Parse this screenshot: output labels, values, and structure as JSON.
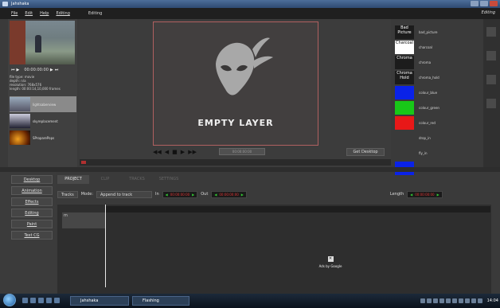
{
  "window": {
    "title": "Jahshaka",
    "mode_right": "Editing"
  },
  "menu": {
    "items": [
      "File",
      "Edit",
      "Help",
      "Editing"
    ],
    "mode_select": "Editing"
  },
  "preview": {
    "time": "00:00:00:00",
    "file_info": [
      "file type: movie",
      "depth: n/a",
      "resolution: 768x576",
      "length: 00:00:14,10,000 frames"
    ]
  },
  "clips": [
    {
      "label": "lightsaberview",
      "selected": true
    },
    {
      "label": "skyreplacement",
      "selected": false
    },
    {
      "label": "SProparePops",
      "selected": false
    }
  ],
  "viewport": {
    "empty_label": "EMPTY LAYER",
    "timecode": "00:00:00:00",
    "get_desktop_label": "Get Desktop"
  },
  "effects": [
    {
      "swatch_text": "Bad Picture",
      "swatch_color": "#1c1c1c",
      "swatch_text_color": "#ffffff",
      "name": "bad_picture"
    },
    {
      "swatch_text": "Charcoal",
      "swatch_color": "#ffffff",
      "swatch_text_color": "#000000",
      "name": "charcoal"
    },
    {
      "swatch_text": "Chroma",
      "swatch_color": "#1c1c1c",
      "swatch_text_color": "#ffffff",
      "name": "chroma"
    },
    {
      "swatch_text": "Chroma Hold",
      "swatch_color": "#1c1c1c",
      "swatch_text_color": "#ffffff",
      "name": "chroma_hold"
    },
    {
      "swatch_text": "",
      "swatch_color": "#0a22e8",
      "swatch_text_color": "#ffffff",
      "name": "colour_blue"
    },
    {
      "swatch_text": "",
      "swatch_color": "#18c818",
      "swatch_text_color": "#ffffff",
      "name": "colour_green"
    },
    {
      "swatch_text": "",
      "swatch_color": "#e81818",
      "swatch_text_color": "#ffffff",
      "name": "colour_red"
    },
    {
      "swatch_text": "",
      "swatch_color": "#3a3a3a",
      "swatch_text_color": "#ffffff",
      "name": "drop_in"
    },
    {
      "swatch_text": "",
      "swatch_color": "#3a3a3a",
      "swatch_text_color": "#ffffff",
      "name": "fly_in"
    },
    {
      "swatch_text": "",
      "swatch_color": "#0a22e8",
      "swatch_text_color": "#ffffff",
      "name": ""
    }
  ],
  "sidebar": {
    "buttons": [
      "Desktop",
      "Animation",
      "Effects",
      "Editing",
      "Paint",
      "Text CG"
    ]
  },
  "tabs": [
    {
      "label": "PROJECT",
      "active": true
    },
    {
      "label": "CLIP",
      "active": false
    },
    {
      "label": "TRACKS",
      "active": false
    },
    {
      "label": "SETTINGS",
      "active": false
    }
  ],
  "trackbar": {
    "tracks_label": "Tracks",
    "mode_label": "Mode:",
    "mode_value": "Append to track",
    "in_label": "In",
    "in_time": "00:00:00:00",
    "out_label": "Out",
    "out_time": "00:00:00:00",
    "length_label": "Length",
    "length_time": "00:00:00:00"
  },
  "timeline": {
    "track_name": "m"
  },
  "ad": {
    "close": "✕",
    "text": "Ads by Google"
  },
  "taskbar": {
    "apps": [
      "Jahshaka",
      "Flashing"
    ],
    "clock": "14:04"
  }
}
